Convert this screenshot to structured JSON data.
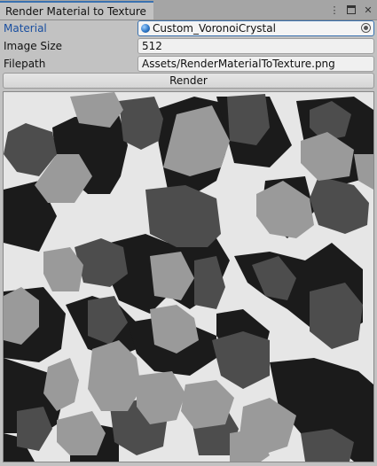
{
  "window": {
    "tab_title": "Render Material to Texture",
    "menu_icon": "vertical-dots-icon",
    "maximize_icon": "maximize-icon",
    "close_icon": "close-icon"
  },
  "form": {
    "material": {
      "label": "Material",
      "value": "Custom_VoronoiCrystal",
      "icon": "material-sphere-icon"
    },
    "image_size": {
      "label": "Image Size",
      "value": "512"
    },
    "filepath": {
      "label": "Filepath",
      "value": "Assets/RenderMaterialToTexture.png"
    }
  },
  "render_button": {
    "label": "Render"
  },
  "preview": {
    "description_icon": "voronoi-texture-preview",
    "palette": {
      "black": "#1b1b1b",
      "dark": "#4d4d4d",
      "mid": "#9a9a9a",
      "light": "#e6e6e6"
    }
  }
}
